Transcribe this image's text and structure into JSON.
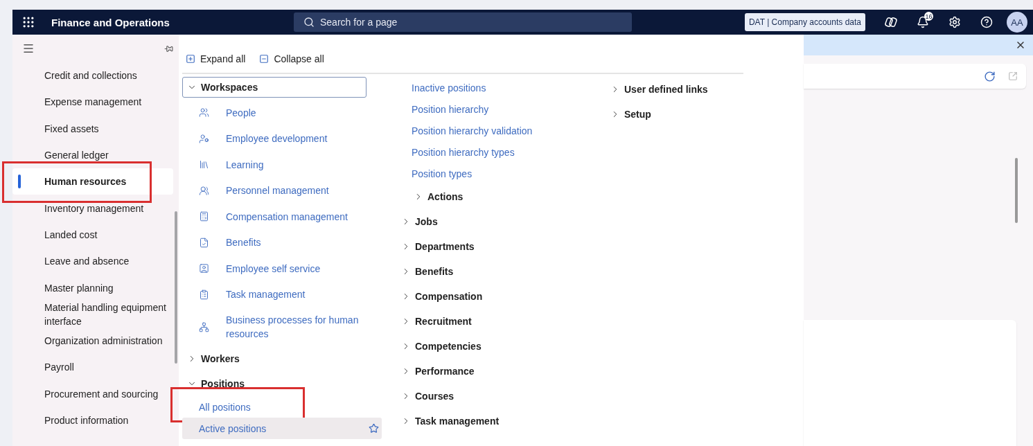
{
  "top_bar": {
    "app_title": "Finance and Operations",
    "search": {
      "placeholder": "Search for a page"
    },
    "company": "DAT | Company accounts data",
    "notifications": "16",
    "avatar": "AA"
  },
  "nav": {
    "items": [
      {
        "label": "Credit and collections",
        "selected": false,
        "annotated": false
      },
      {
        "label": "Expense management",
        "selected": false,
        "annotated": false
      },
      {
        "label": "Fixed assets",
        "selected": false,
        "annotated": false
      },
      {
        "label": "General ledger",
        "selected": false,
        "annotated": false
      },
      {
        "label": "Human resources",
        "selected": true,
        "annotated": true
      },
      {
        "label": "Inventory management",
        "selected": false,
        "annotated": false
      },
      {
        "label": "Landed cost",
        "selected": false,
        "annotated": false
      },
      {
        "label": "Leave and absence",
        "selected": false,
        "annotated": false
      },
      {
        "label": "Master planning",
        "selected": false,
        "annotated": false
      },
      {
        "label": "Material handling equipment interface",
        "selected": false,
        "annotated": false
      },
      {
        "label": "Organization administration",
        "selected": false,
        "annotated": false
      },
      {
        "label": "Payroll",
        "selected": false,
        "annotated": false
      },
      {
        "label": "Procurement and sourcing",
        "selected": false,
        "annotated": false
      },
      {
        "label": "Product information",
        "selected": false,
        "annotated": false
      }
    ]
  },
  "flyout": {
    "actions": [
      "Expand all",
      "Collapse all"
    ],
    "columns": [
      [
        {
          "kind": "group",
          "label": "Workspaces",
          "expanded": true,
          "focused": true,
          "children": [
            {
              "kind": "workspace",
              "label": "People"
            },
            {
              "kind": "workspace",
              "label": "Employee development"
            },
            {
              "kind": "workspace",
              "label": "Learning"
            },
            {
              "kind": "workspace",
              "label": "Personnel management"
            },
            {
              "kind": "workspace",
              "label": "Compensation management"
            },
            {
              "kind": "workspace",
              "label": "Benefits"
            },
            {
              "kind": "workspace",
              "label": "Employee self service"
            },
            {
              "kind": "workspace",
              "label": "Task management"
            },
            {
              "kind": "workspace",
              "label": "Business processes for human resources"
            }
          ]
        },
        {
          "kind": "group",
          "label": "Workers",
          "expanded": false,
          "focused": false
        },
        {
          "kind": "group",
          "label": "Positions",
          "expanded": true,
          "focused": false,
          "children": [
            {
              "kind": "link",
              "label": "All positions",
              "annotated": true,
              "hovered": false
            },
            {
              "kind": "link",
              "label": "Active positions",
              "annotated": false,
              "hovered": true
            }
          ]
        }
      ],
      [
        {
          "kind": "link",
          "label": "Inactive positions",
          "annotated": false,
          "hovered": false
        },
        {
          "kind": "link",
          "label": "Position hierarchy",
          "annotated": false,
          "hovered": false
        },
        {
          "kind": "link",
          "label": "Position hierarchy validation",
          "annotated": false,
          "hovered": false
        },
        {
          "kind": "link",
          "label": "Position hierarchy types",
          "annotated": false,
          "hovered": false
        },
        {
          "kind": "link",
          "label": "Position types",
          "annotated": false,
          "hovered": false
        },
        {
          "kind": "subgroup",
          "label": "Actions",
          "expanded": false,
          "focused": false
        },
        {
          "kind": "group",
          "label": "Jobs",
          "expanded": false,
          "focused": false
        },
        {
          "kind": "group",
          "label": "Departments",
          "expanded": false,
          "focused": false
        },
        {
          "kind": "group",
          "label": "Benefits",
          "expanded": false,
          "focused": false
        },
        {
          "kind": "group",
          "label": "Compensation",
          "expanded": false,
          "focused": false
        },
        {
          "kind": "group",
          "label": "Recruitment",
          "expanded": false,
          "focused": false
        },
        {
          "kind": "group",
          "label": "Competencies",
          "expanded": false,
          "focused": false
        },
        {
          "kind": "group",
          "label": "Performance",
          "expanded": false,
          "focused": false
        },
        {
          "kind": "group",
          "label": "Courses",
          "expanded": false,
          "focused": false
        },
        {
          "kind": "group",
          "label": "Task management",
          "expanded": false,
          "focused": false
        }
      ],
      [
        {
          "kind": "group",
          "label": "User defined links",
          "expanded": false,
          "focused": false
        },
        {
          "kind": "group",
          "label": "Setup",
          "expanded": false,
          "focused": false
        }
      ]
    ]
  }
}
